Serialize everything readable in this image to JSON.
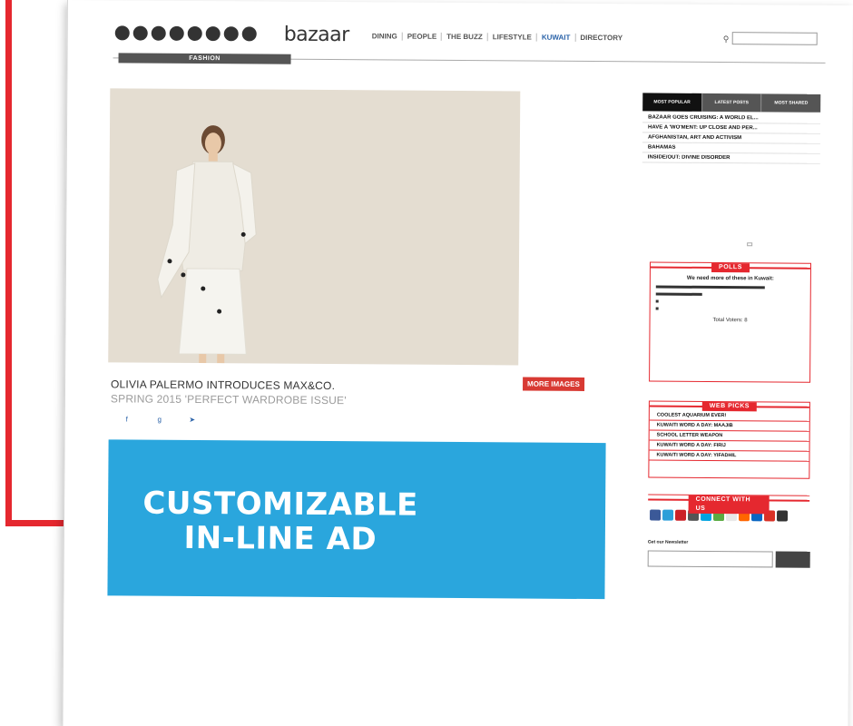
{
  "header": {
    "logo": "bazaar",
    "nav": [
      "DINING",
      "PEOPLE",
      "THE BUZZ",
      "LIFESTYLE",
      "KUWAIT",
      "DIRECTORY"
    ],
    "active_nav": "KUWAIT",
    "search_placeholder": ""
  },
  "section_label": "FASHION",
  "article": {
    "title": "OLIVIA PALERMO INTRODUCES MAX&CO.",
    "subtitle": "SPRING 2015 'PERFECT WARDROBE ISSUE'",
    "more_images_label": "MORE IMAGES"
  },
  "ad": {
    "line1": "CUSTOMIZABLE",
    "line2": "IN-LINE AD"
  },
  "sidebar": {
    "tabs": [
      "MOST POPULAR",
      "LATEST POSTS",
      "MOST SHARED"
    ],
    "popular": [
      {
        "title": "BAZAAR GOES CRUISING: A WORLD EL..."
      },
      {
        "title": "HAVE A 'WO'MENT: UP CLOSE AND PER..."
      },
      {
        "title": "AFGHANISTAN, ART AND ACTIVISM"
      },
      {
        "title": "BAHAMAS"
      },
      {
        "title": "INSIDE/OUT: DIVINE DISORDER"
      }
    ],
    "polls": {
      "heading": "POLLS",
      "question": "We need more of these in Kuwait:",
      "total_label": "Total Voters: 8",
      "options": [
        {
          "fraction": 0.75
        },
        {
          "fraction": 0.32
        },
        {
          "fraction": 0.02
        },
        {
          "fraction": 0.02
        }
      ]
    },
    "web_picks": {
      "heading": "WEB PICKS",
      "items": [
        "COOLEST AQUARIUM EVER!",
        "KUWAITI WORD A DAY: MAAJIB",
        "SCHOOL LETTER WEAPON",
        "KUWAITI WORD A DAY: FIRIJ",
        "KUWAITI WORD A DAY: YIFADHIL"
      ]
    },
    "connect": {
      "heading": "CONNECT WITH US",
      "icon_colors": [
        "#3b5998",
        "#2d9fd9",
        "#cc2127",
        "#555555",
        "#00a3e0",
        "#5aab42",
        "#e8e8e8",
        "#ff6600",
        "#0a66c2",
        "#d93025",
        "#333333"
      ]
    },
    "newsletter": {
      "label": "Get our Newsletter"
    }
  }
}
